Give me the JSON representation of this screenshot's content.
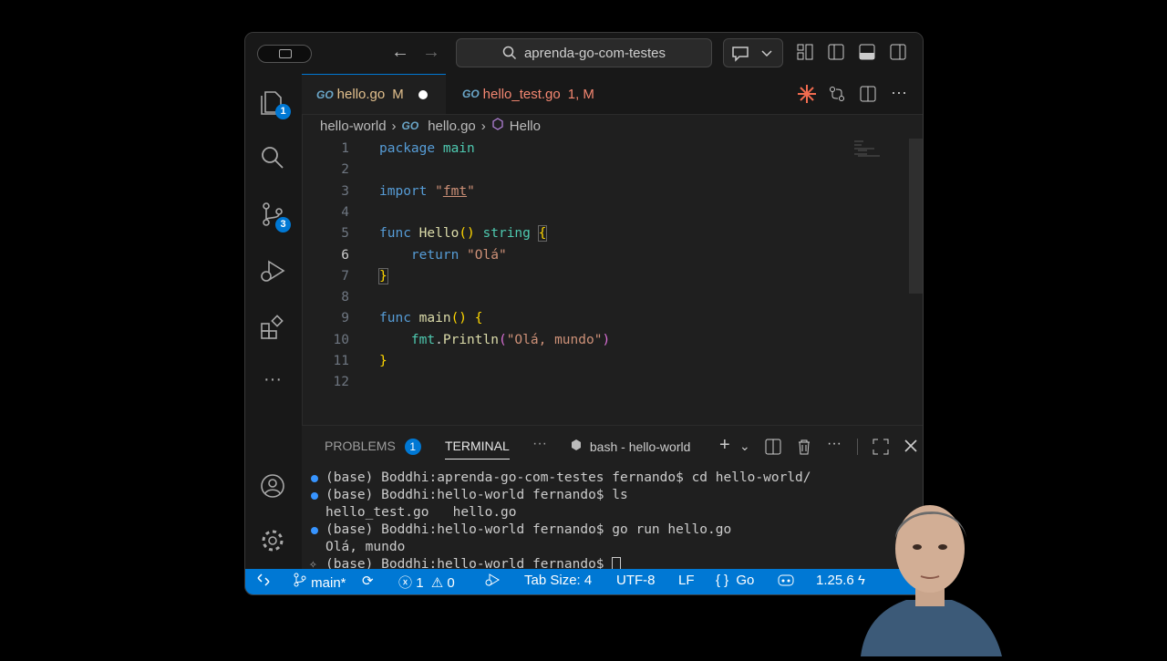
{
  "titlebar": {
    "search_text": "aprenda-go-com-testes"
  },
  "activity": {
    "explorer_badge": "1",
    "scm_badge": "3"
  },
  "tabs": [
    {
      "label": "hello.go",
      "suffix": "M",
      "go_mark": "GO"
    },
    {
      "label": "hello_test.go",
      "suffix": "1, M",
      "go_mark": "GO"
    }
  ],
  "breadcrumb": {
    "folder": "hello-world",
    "file": "hello.go",
    "symbol": "Hello",
    "go_mark": "GO"
  },
  "editor": {
    "line_numbers": [
      "1",
      "2",
      "3",
      "4",
      "5",
      "6",
      "7",
      "8",
      "9",
      "10",
      "11",
      "12"
    ]
  },
  "panel": {
    "problems_label": "PROBLEMS",
    "problems_count": "1",
    "terminal_label": "TERMINAL",
    "more": "···",
    "shell_label": "bash - hello-world",
    "terminal_lines": [
      "(base) Boddhi:aprenda-go-com-testes fernando$ cd hello-world/",
      "(base) Boddhi:hello-world fernando$ ls",
      "hello_test.go   hello.go",
      "(base) Boddhi:hello-world fernando$ go run hello.go",
      "Olá, mundo",
      "(base) Boddhi:hello-world fernando$ "
    ]
  },
  "status": {
    "branch": "main*",
    "errors": "1",
    "warnings": "0",
    "tab_size": "Tab Size: 4",
    "encoding": "UTF-8",
    "eol": "LF",
    "language": "Go",
    "go_version": "1.25.6"
  },
  "colors": {
    "accent": "#0078d4",
    "editor_bg": "#1f1f1f",
    "keyword": "#569cd6",
    "string": "#ce9178",
    "function": "#dcdcaa",
    "modified_tab": "#e2c08d",
    "error_tab": "#f48771"
  }
}
